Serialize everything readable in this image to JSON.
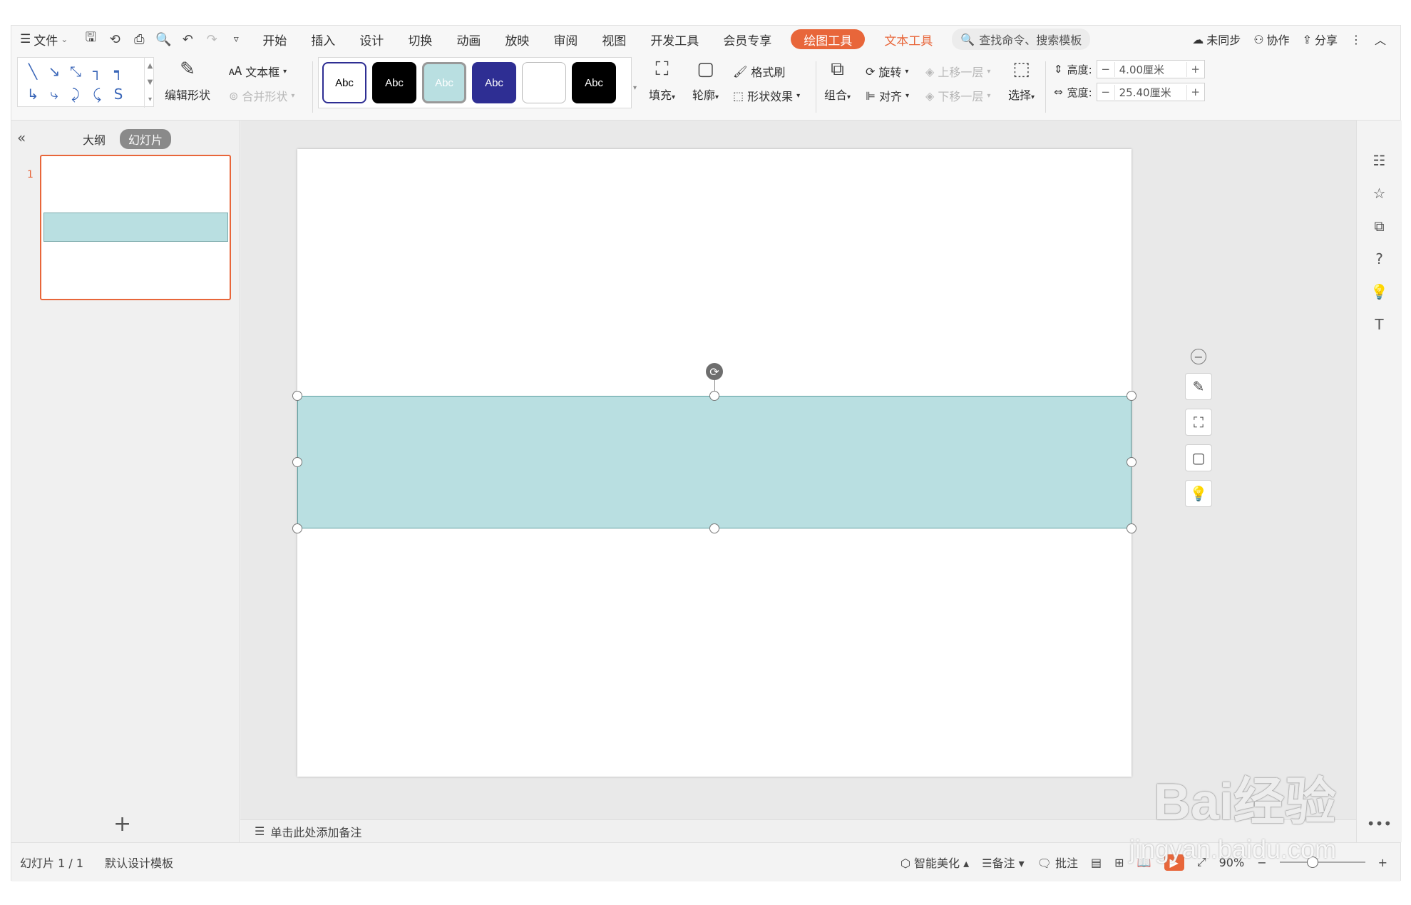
{
  "menubar": {
    "file": "文件",
    "tabs": [
      "开始",
      "插入",
      "设计",
      "切换",
      "动画",
      "放映",
      "审阅",
      "视图",
      "开发工具",
      "会员专享"
    ],
    "drawing_tools": "绘图工具",
    "text_tools": "文本工具",
    "search": "查找命令、搜索模板",
    "unsynced": "未同步",
    "collaborate": "协作",
    "share": "分享"
  },
  "ribbon": {
    "edit_shape": "编辑形状",
    "text_box": "文本框",
    "merge_shape": "合并形状",
    "styles": [
      "Abc",
      "Abc",
      "Abc",
      "Abc",
      "",
      "Abc"
    ],
    "fill": "填充",
    "outline": "轮廓",
    "format_painter": "格式刷",
    "shape_effects": "形状效果",
    "group": "组合",
    "rotate": "旋转",
    "align": "对齐",
    "bring_forward": "上移一层",
    "send_backward": "下移一层",
    "select": "选择",
    "height_label": "高度:",
    "height_value": "4.00厘米",
    "width_label": "宽度:",
    "width_value": "25.40厘米"
  },
  "leftpane": {
    "outline_tab": "大纲",
    "slides_tab": "幻灯片",
    "slide_number": "1"
  },
  "notes": {
    "placeholder": "单击此处添加备注"
  },
  "statusbar": {
    "slide_count": "幻灯片 1 / 1",
    "template": "默认设计模板",
    "beautify": "智能美化",
    "notes": "备注",
    "comments": "批注",
    "zoom": "90%"
  },
  "watermark": {
    "brand": "Bai经验",
    "url": "jingyan.baidu.com"
  },
  "colors": {
    "accent": "#e8663a",
    "shape_fill": "#b9dfe1",
    "style_dark_blue": "#2e2e93"
  }
}
